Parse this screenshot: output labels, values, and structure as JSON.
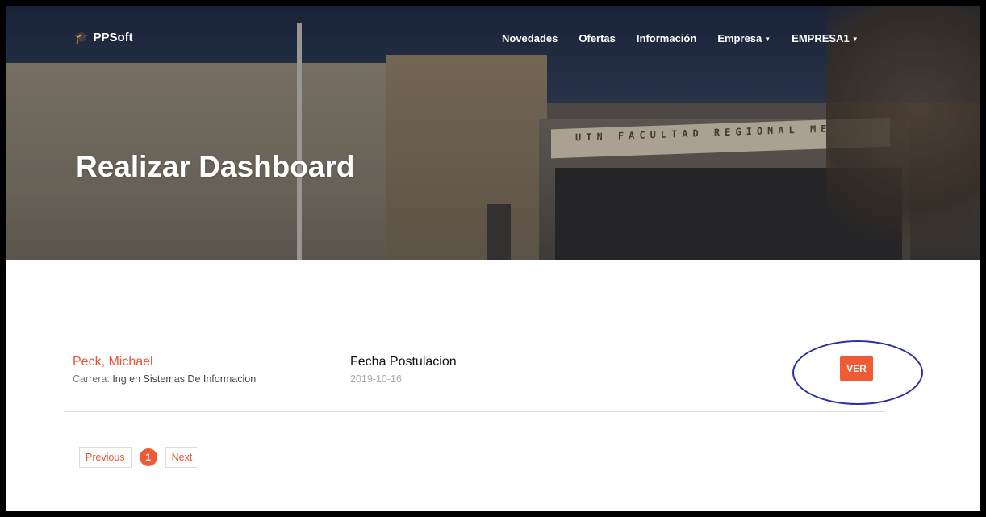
{
  "brand": {
    "name": "PPSoft",
    "icon": "graduation-cap-icon"
  },
  "nav": {
    "items": [
      "Novedades",
      "Ofertas",
      "Información",
      "Empresa",
      "EMPRESA1"
    ]
  },
  "hero": {
    "title": "Realizar Dashboard",
    "sign_text": "UTN FACULTAD REGIONAL ME"
  },
  "postulation": {
    "name": "Peck, Michael",
    "career_label": "Carrera:",
    "career_value": "Ing en Sistemas De Informacion",
    "date_label": "Fecha Postulacion",
    "date_value": "2019-10-16",
    "action_label": "VER"
  },
  "pagination": {
    "previous": "Previous",
    "current": "1",
    "next": "Next"
  },
  "colors": {
    "accent": "#f05a34",
    "link": "#e8553a",
    "annotation": "#2b2fa6"
  }
}
